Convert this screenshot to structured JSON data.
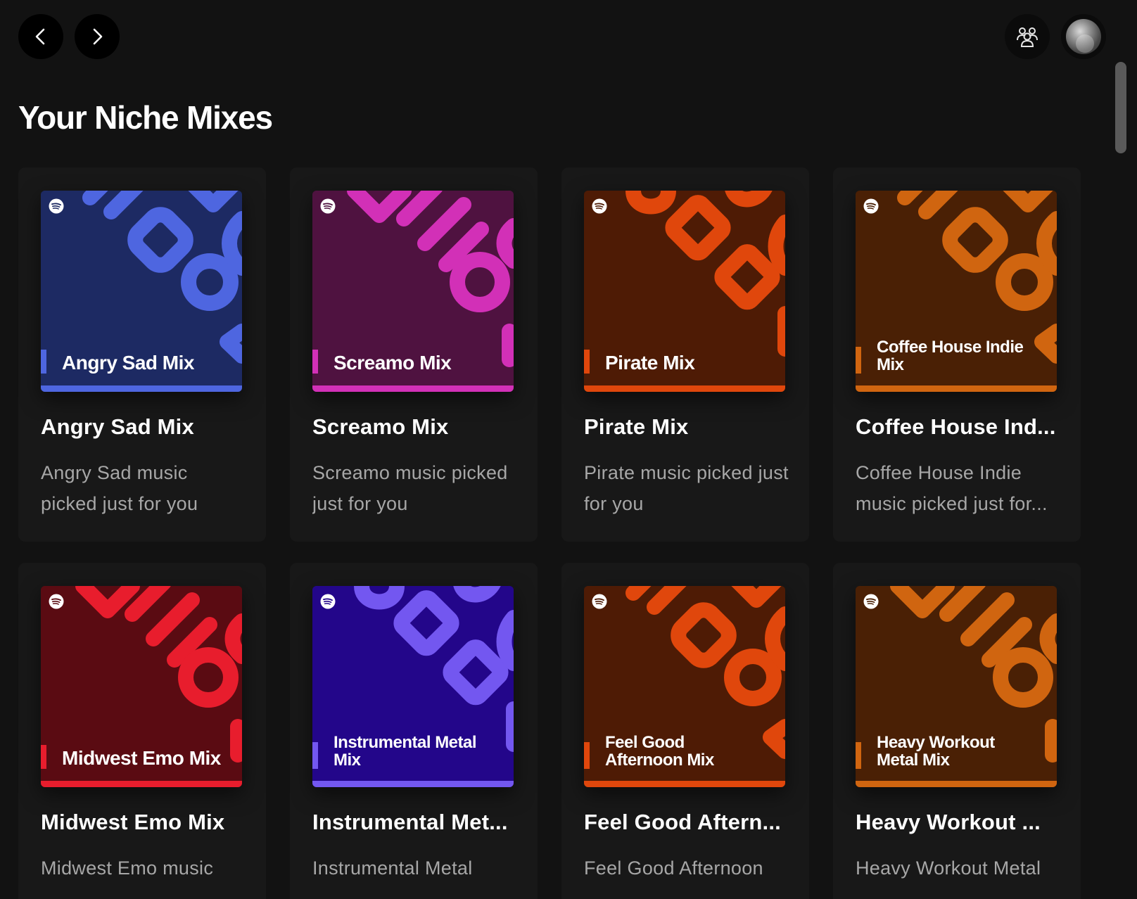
{
  "header": {
    "back_icon": "chevron-left-icon",
    "forward_icon": "chevron-right-icon",
    "friends_icon": "friend-activity-icon",
    "avatar": "user-avatar"
  },
  "section": {
    "title": "Your Niche Mixes"
  },
  "cards": [
    {
      "cover_label": "Angry Sad Mix",
      "title": "Angry Sad Mix",
      "description": "Angry Sad music picked just for you",
      "bg": "#1d2a63",
      "accent": "#4e66e0"
    },
    {
      "cover_label": "Screamo Mix",
      "title": "Screamo Mix",
      "description": "Screamo music picked just for you",
      "bg": "#4f1240",
      "accent": "#d230b7"
    },
    {
      "cover_label": "Pirate Mix",
      "title": "Pirate Mix",
      "description": "Pirate music picked just for you",
      "bg": "#4e1b05",
      "accent": "#e0470c"
    },
    {
      "cover_label": "Coffee House Indie Mix",
      "title": "Coffee House Ind...",
      "description": "Coffee House Indie music picked just for...",
      "bg": "#4a2005",
      "accent": "#d06510"
    },
    {
      "cover_label": "Midwest Emo Mix",
      "title": "Midwest Emo Mix",
      "description": "Midwest Emo music",
      "bg": "#5a0b12",
      "accent": "#e81d2d"
    },
    {
      "cover_label": "Instrumental Metal Mix",
      "title": "Instrumental Met...",
      "description": "Instrumental Metal",
      "bg": "#23068a",
      "accent": "#7357f0"
    },
    {
      "cover_label": "Feel Good Afternoon Mix",
      "title": "Feel Good Aftern...",
      "description": "Feel Good Afternoon",
      "bg": "#4e1b05",
      "accent": "#e0470c"
    },
    {
      "cover_label": "Heavy Workout Metal Mix",
      "title": "Heavy Workout ...",
      "description": "Heavy Workout Metal",
      "bg": "#4a2005",
      "accent": "#d06510"
    }
  ]
}
